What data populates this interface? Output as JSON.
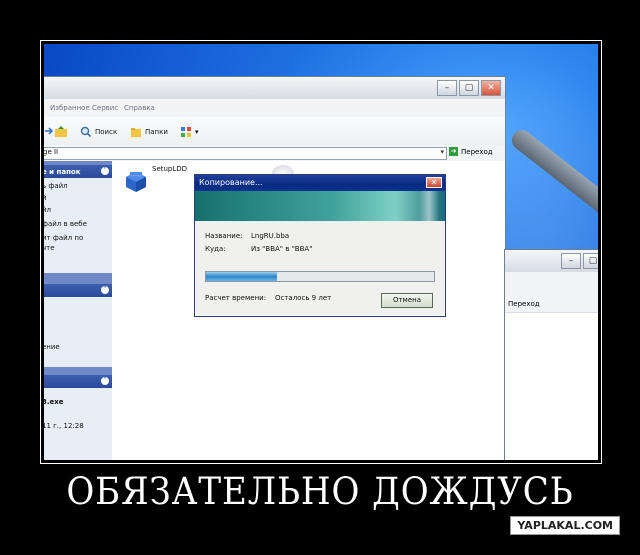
{
  "explorer": {
    "menu": [
      "Избранное",
      "Сервис",
      "Справка"
    ],
    "toolbar": {
      "search_label": "Поиск",
      "folders_label": "Папки"
    },
    "address": {
      "value": "ge II",
      "go_label": "Переход"
    },
    "sidebar": {
      "panel1_title": "е и папок",
      "panel1_items": [
        "ь файл",
        "й",
        "йл",
        "файл в вебе",
        "ит файл по",
        "чте"
      ],
      "panel3_items": [
        "3.exe",
        "11 г., 12:28"
      ],
      "panel2_items": [
        "",
        "",
        "ение"
      ]
    },
    "file_label": "SetupLDD"
  },
  "dialog": {
    "title": "Копирование...",
    "name_label": "Название:",
    "name_value": "LngRU.bba",
    "dest_label": "Куда:",
    "dest_value": "Из \"BBA\" в \"BBA\"",
    "progress": 0.31,
    "time_label": "Расчет времени:",
    "time_value": "Осталось 9 лет",
    "cancel_label": "Отмена"
  },
  "second_window": {
    "address_label": "Переход"
  },
  "caption": "ОБЯЗАТЕЛЬНО ДОЖДУСЬ",
  "watermark": "YAPLAKAL.COM"
}
